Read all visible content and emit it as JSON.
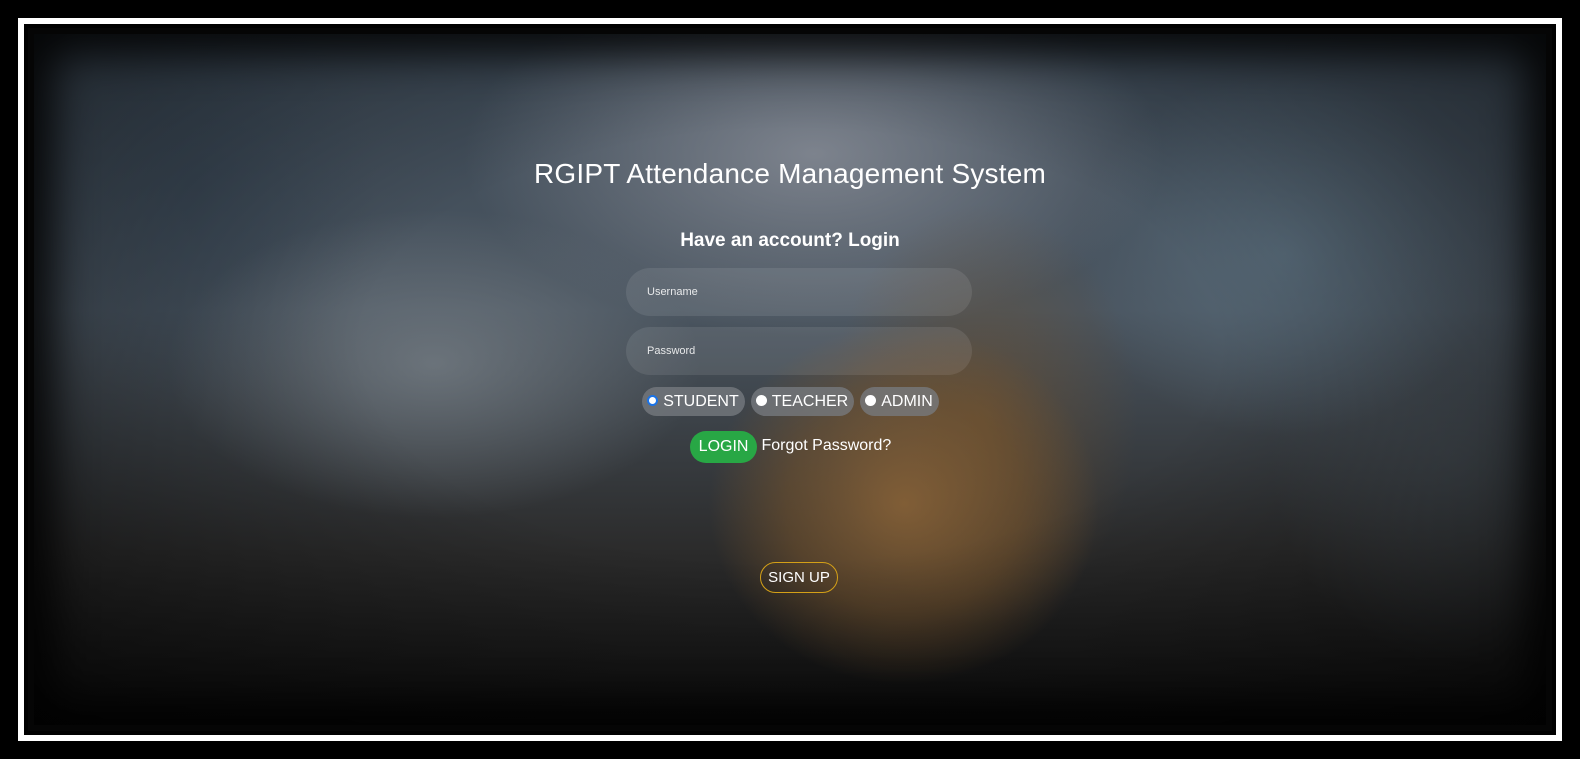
{
  "header": {
    "title": "RGIPT Attendance Management System",
    "subtitle": "Have an account? Login"
  },
  "form": {
    "username_placeholder": "Username",
    "username_value": "",
    "password_placeholder": "Password",
    "password_value": "",
    "roles": [
      {
        "label": "STUDENT",
        "selected": true
      },
      {
        "label": "TEACHER",
        "selected": false
      },
      {
        "label": "ADMIN",
        "selected": false
      }
    ],
    "login_label": "LOGIN",
    "forgot_label": "Forgot Password?",
    "signup_label": "SIGN UP"
  },
  "colors": {
    "login_button": "#28a745",
    "signup_border": "#d4a017",
    "radio_selected": "#1a73e8",
    "frame_border": "#ffffff"
  }
}
